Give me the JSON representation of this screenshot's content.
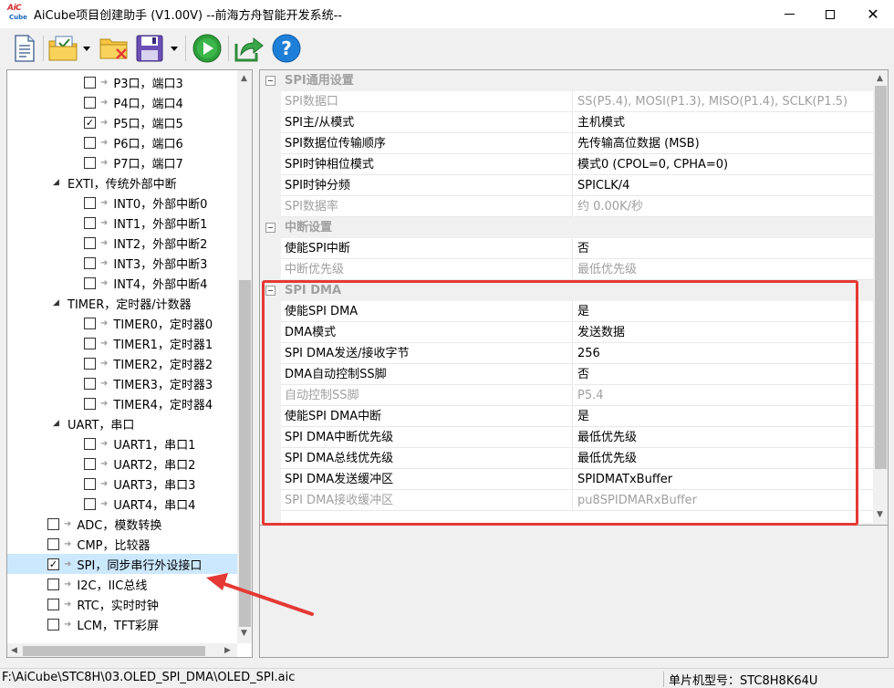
{
  "window": {
    "title": "AiCube项目创建助手 (V1.00V) --前海方舟智能开发系统--",
    "logo_top": "AiC",
    "logo_bottom": "Cube"
  },
  "toolbar": {
    "icons": [
      "new-document-icon",
      "open-folder-icon",
      "close-project-icon",
      "save-icon",
      "run-icon",
      "export-icon",
      "help-icon"
    ]
  },
  "tree": {
    "items": [
      {
        "label": "P3口，端口3",
        "checked": false,
        "level": 2
      },
      {
        "label": "P4口，端口4",
        "checked": false,
        "level": 2
      },
      {
        "label": "P5口，端口5",
        "checked": true,
        "level": 2
      },
      {
        "label": "P6口，端口6",
        "checked": false,
        "level": 2
      },
      {
        "label": "P7口，端口7",
        "checked": false,
        "level": 2
      },
      {
        "label": "EXTI，传统外部中断",
        "group": true,
        "level": 1
      },
      {
        "label": "INT0，外部中断0",
        "checked": false,
        "level": 2
      },
      {
        "label": "INT1，外部中断1",
        "checked": false,
        "level": 2
      },
      {
        "label": "INT2，外部中断2",
        "checked": false,
        "level": 2
      },
      {
        "label": "INT3，外部中断3",
        "checked": false,
        "level": 2
      },
      {
        "label": "INT4，外部中断4",
        "checked": false,
        "level": 2
      },
      {
        "label": "TIMER，定时器/计数器",
        "group": true,
        "level": 1
      },
      {
        "label": "TIMER0，定时器0",
        "checked": false,
        "level": 2
      },
      {
        "label": "TIMER1，定时器1",
        "checked": false,
        "level": 2
      },
      {
        "label": "TIMER2，定时器2",
        "checked": false,
        "level": 2
      },
      {
        "label": "TIMER3，定时器3",
        "checked": false,
        "level": 2
      },
      {
        "label": "TIMER4，定时器4",
        "checked": false,
        "level": 2
      },
      {
        "label": "UART，串口",
        "group": true,
        "level": 1
      },
      {
        "label": "UART1，串口1",
        "checked": false,
        "level": 2
      },
      {
        "label": "UART2，串口2",
        "checked": false,
        "level": 2
      },
      {
        "label": "UART3，串口3",
        "checked": false,
        "level": 2
      },
      {
        "label": "UART4，串口4",
        "checked": false,
        "level": 2
      },
      {
        "label": "ADC，模数转换",
        "checked": false,
        "level": 1
      },
      {
        "label": "CMP，比较器",
        "checked": false,
        "level": 1
      },
      {
        "label": "SPI，同步串行外设接口",
        "checked": true,
        "level": 1,
        "selected": true
      },
      {
        "label": "I2C，IIC总线",
        "checked": false,
        "level": 1
      },
      {
        "label": "RTC，实时时钟",
        "checked": false,
        "level": 1
      },
      {
        "label": "LCM，TFT彩屏",
        "checked": false,
        "level": 1
      }
    ]
  },
  "grid": {
    "rows": [
      {
        "type": "cat",
        "label": "SPI通用设置"
      },
      {
        "key": "SPI数据口",
        "value": "SS(P5.4), MOSI(P1.3), MISO(P1.4), SCLK(P1.5)",
        "disabled": true
      },
      {
        "key": "SPI主/从模式",
        "value": "主机模式"
      },
      {
        "key": "SPI数据位传输顺序",
        "value": "先传输高位数据 (MSB)"
      },
      {
        "key": "SPI时钟相位模式",
        "value": "模式0 (CPOL=0, CPHA=0)"
      },
      {
        "key": "SPI时钟分频",
        "value": "SPICLK/4"
      },
      {
        "key": "SPI数据率",
        "value": "约 0.00K/秒",
        "disabled": true
      },
      {
        "type": "cat",
        "label": "中断设置"
      },
      {
        "key": "使能SPI中断",
        "value": "否"
      },
      {
        "key": "中断优先级",
        "value": "最低优先级",
        "disabled": true
      },
      {
        "type": "cat",
        "label": "SPI DMA"
      },
      {
        "key": "使能SPI DMA",
        "value": "是"
      },
      {
        "key": "DMA模式",
        "value": "发送数据"
      },
      {
        "key": "SPI DMA发送/接收字节",
        "value": "256"
      },
      {
        "key": "DMA自动控制SS脚",
        "value": "否"
      },
      {
        "key": "自动控制SS脚",
        "value": "P5.4",
        "disabled": true
      },
      {
        "key": "使能SPI DMA中断",
        "value": "是"
      },
      {
        "key": "SPI DMA中断优先级",
        "value": "最低优先级"
      },
      {
        "key": "SPI DMA总线优先级",
        "value": "最低优先级"
      },
      {
        "key": "SPI DMA发送缓冲区",
        "value": "SPIDMATxBuffer"
      },
      {
        "key": "SPI DMA接收缓冲区",
        "value": "pu8SPIDMARxBuffer",
        "disabled": true
      }
    ]
  },
  "status": {
    "path": "F:\\AiCube\\STC8H\\03.OLED_SPI_DMA\\OLED_SPI.aic",
    "chip": "单片机型号：STC8H8K64U"
  },
  "colors": {
    "annotation": "#e53935",
    "selected_row": "#cce8ff"
  }
}
